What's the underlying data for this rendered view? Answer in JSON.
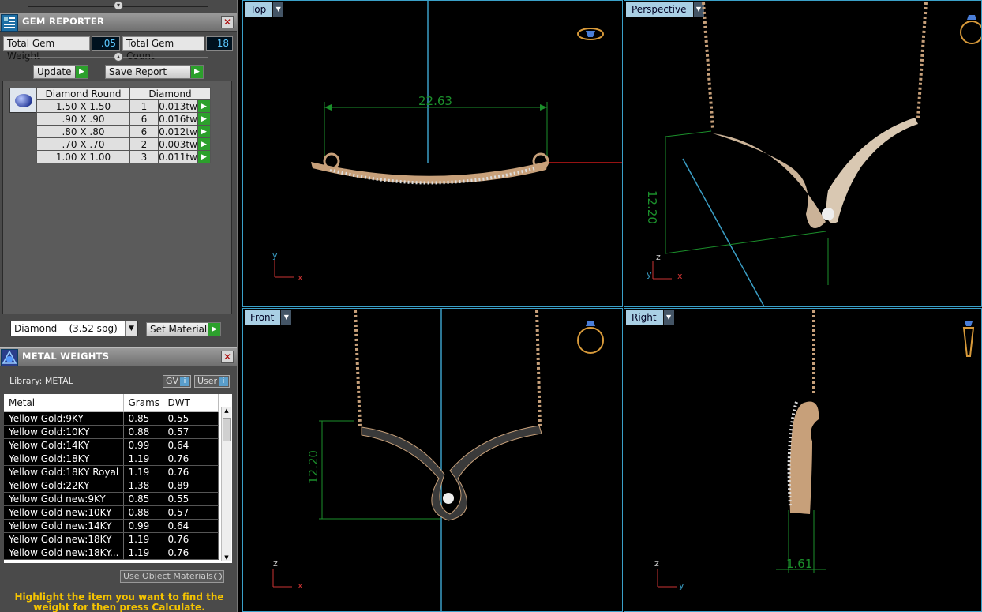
{
  "gem_reporter": {
    "title": "GEM REPORTER",
    "total_weight_label": "Total Gem Weight",
    "total_weight_value": ".05",
    "total_count_label": "Total Gem Count",
    "total_count_value": "18",
    "update_label": "Update",
    "save_report_label": "Save Report",
    "table_headers": [
      "Diamond Round",
      "Diamond"
    ],
    "rows": [
      {
        "size": "1.50 X 1.50",
        "count": "1",
        "weight": "0.013tw"
      },
      {
        "size": ".90 X .90",
        "count": "6",
        "weight": "0.016tw"
      },
      {
        "size": ".80 X .80",
        "count": "6",
        "weight": "0.012tw"
      },
      {
        "size": ".70 X .70",
        "count": "2",
        "weight": "0.003tw"
      },
      {
        "size": "1.00 X 1.00",
        "count": "3",
        "weight": "0.011tw"
      }
    ],
    "material_select": "Diamond    (3.52 spg)",
    "set_material_label": "Set Material"
  },
  "metal_weights": {
    "title": "METAL WEIGHTS",
    "library_label": "Library: METAL",
    "toggle_gv": "GV",
    "toggle_user": "User",
    "headers": [
      "Metal",
      "Grams",
      "DWT"
    ],
    "rows": [
      {
        "metal": "Yellow Gold:9KY",
        "grams": "0.85",
        "dwt": "0.55"
      },
      {
        "metal": "Yellow Gold:10KY",
        "grams": "0.88",
        "dwt": "0.57"
      },
      {
        "metal": "Yellow Gold:14KY",
        "grams": "0.99",
        "dwt": "0.64"
      },
      {
        "metal": "Yellow Gold:18KY",
        "grams": "1.19",
        "dwt": "0.76"
      },
      {
        "metal": "Yellow Gold:18KY Royal",
        "grams": "1.19",
        "dwt": "0.76"
      },
      {
        "metal": "Yellow Gold:22KY",
        "grams": "1.38",
        "dwt": "0.89"
      },
      {
        "metal": "Yellow Gold new:9KY",
        "grams": "0.85",
        "dwt": "0.55"
      },
      {
        "metal": "Yellow Gold new:10KY",
        "grams": "0.88",
        "dwt": "0.57"
      },
      {
        "metal": "Yellow Gold new:14KY",
        "grams": "0.99",
        "dwt": "0.64"
      },
      {
        "metal": "Yellow Gold new:18KY",
        "grams": "1.19",
        "dwt": "0.76"
      },
      {
        "metal": "Yellow Gold new:18KY...",
        "grams": "1.19",
        "dwt": "0.76"
      }
    ],
    "use_object_materials": "Use Object Materials",
    "hint": "Highlight the item you want to find the weight for then press Calculate."
  },
  "viewports": {
    "top": {
      "label": "Top",
      "dimension": "22.63"
    },
    "perspective": {
      "label": "Perspective",
      "dimension": "12.20"
    },
    "front": {
      "label": "Front",
      "dimension": "12.20"
    },
    "right": {
      "label": "Right",
      "dimension": "1.61"
    }
  },
  "axes": {
    "x": "x",
    "y": "y",
    "z": "z"
  }
}
